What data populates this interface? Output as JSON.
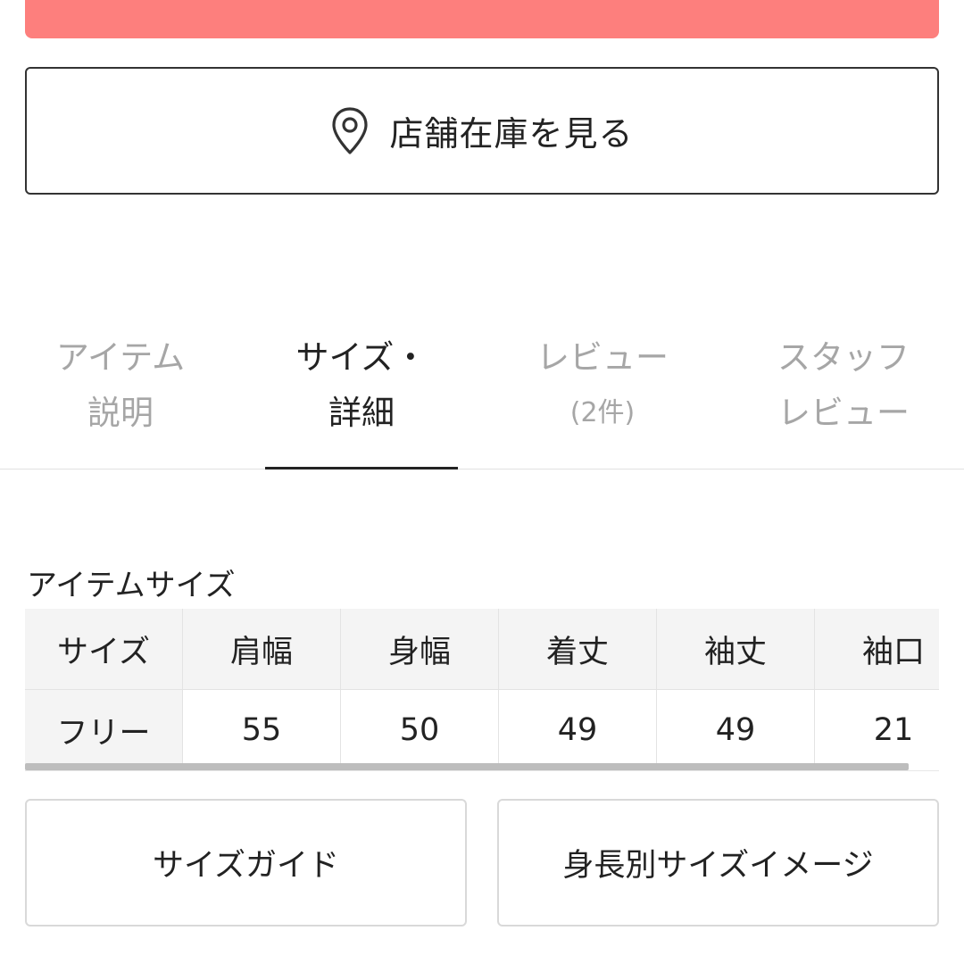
{
  "store_stock": {
    "label": "店舗在庫を見る",
    "icon": "map-pin-icon"
  },
  "tabs": [
    {
      "line1": "アイテム",
      "line2": "説明",
      "active": false
    },
    {
      "line1": "サイズ・",
      "line2": "詳細",
      "active": true
    },
    {
      "line1": "レビュー",
      "line2": "(2件)",
      "active": false
    },
    {
      "line1": "スタッフ",
      "line2": "レビュー",
      "active": false
    }
  ],
  "size_section": {
    "title": "アイテムサイズ",
    "headers": [
      "サイズ",
      "肩幅",
      "身幅",
      "着丈",
      "袖丈",
      "袖口"
    ],
    "rows": [
      [
        "フリー",
        "55",
        "50",
        "49",
        "49",
        "21"
      ]
    ]
  },
  "buttons": {
    "size_guide": "サイズガイド",
    "height_image": "身長別サイズイメージ"
  },
  "colors": {
    "accent": "#fd7f7d",
    "text": "#222222",
    "inactive_tab": "#a6a6a6"
  }
}
